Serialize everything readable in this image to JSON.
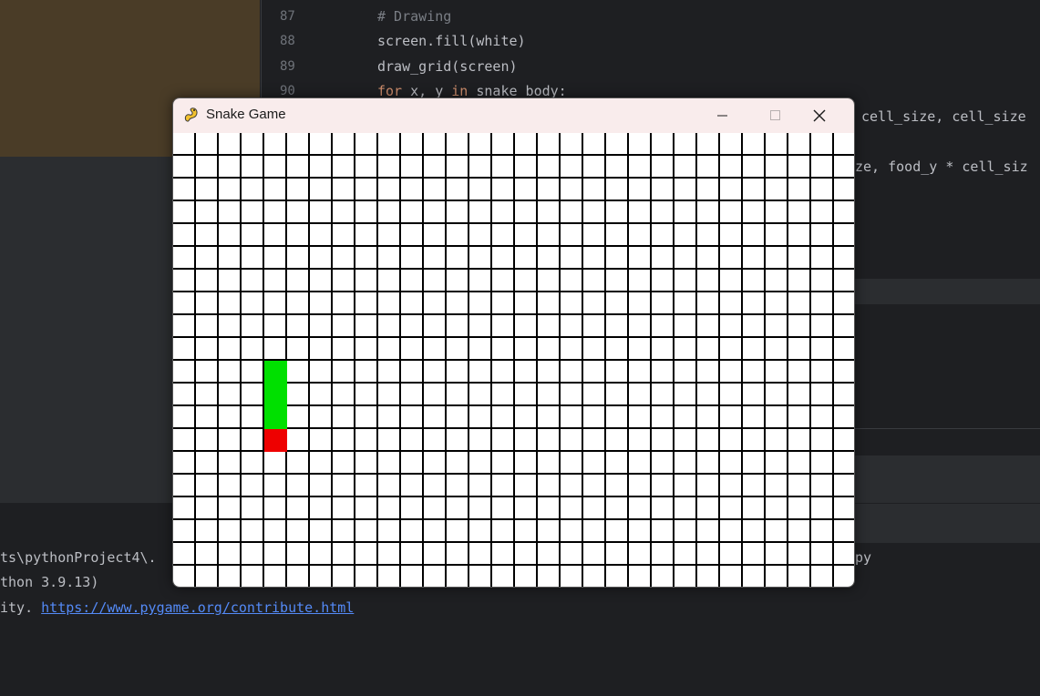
{
  "ide": {
    "line_numbers": [
      "87",
      "88",
      "89",
      "90"
    ],
    "code": [
      {
        "text": "# Drawing",
        "kind": "comment"
      },
      {
        "text": "screen.fill(white)",
        "kind": "code"
      },
      {
        "text": "draw_grid(screen)",
        "kind": "code"
      }
    ],
    "line90_kw1": "for",
    "line90_mid": " x, y ",
    "line90_kw2": "in",
    "line90_rest": " snake_body:",
    "right_line1": " cell_size, cell_size",
    "right_line2": "ze, food_y * cell_siz",
    "console_line1": "ts\\pythonProject4\\.",
    "console_line1_right": "py",
    "console_line2": "thon 3.9.13)",
    "console_line3_prefix": "ity. ",
    "console_link": "https://www.pygame.org/contribute.html"
  },
  "window": {
    "title": "Snake Game",
    "icon": "pygame-snake-icon",
    "controls": [
      "minimize-icon",
      "maximize-icon",
      "close-icon"
    ]
  },
  "game": {
    "grid": {
      "columns": 30,
      "rows": 20
    },
    "colors": {
      "background": "#ffffff",
      "grid_line": "#000000",
      "snake": "#00e000",
      "food": "#ee0000"
    },
    "snake_body": [
      [
        4,
        10
      ],
      [
        4,
        11
      ],
      [
        4,
        12
      ]
    ],
    "food": [
      4,
      13
    ]
  }
}
